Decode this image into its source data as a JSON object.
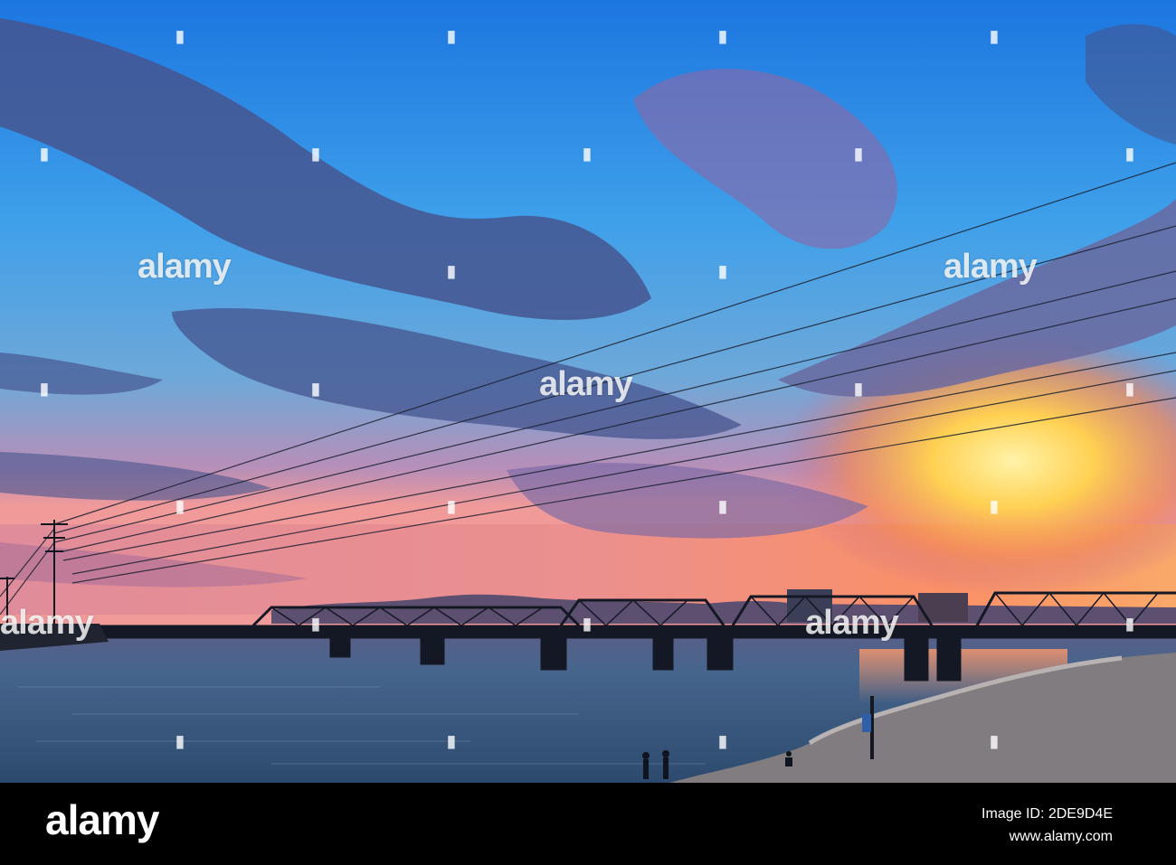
{
  "photo": {
    "subject": "Sunset over lake with truss bridge, power lines and people on shore",
    "colors": {
      "sky_top": "#1f7ee6",
      "sky_mid": "#4aa6ea",
      "sunset_glow": "#ffd457",
      "horizon_orange": "#ff8a4a",
      "clouds": "#4a5a95",
      "water": "#3a5578",
      "shore": "#7d7a7c",
      "silhouette": "#10141f"
    }
  },
  "watermarks": [
    "alamy",
    "alamy",
    "alamy",
    "alamy",
    "alamy"
  ],
  "footer": {
    "logo": "alamy",
    "image_id": "Image ID: 2DE9D4E",
    "website": "www.alamy.com"
  }
}
